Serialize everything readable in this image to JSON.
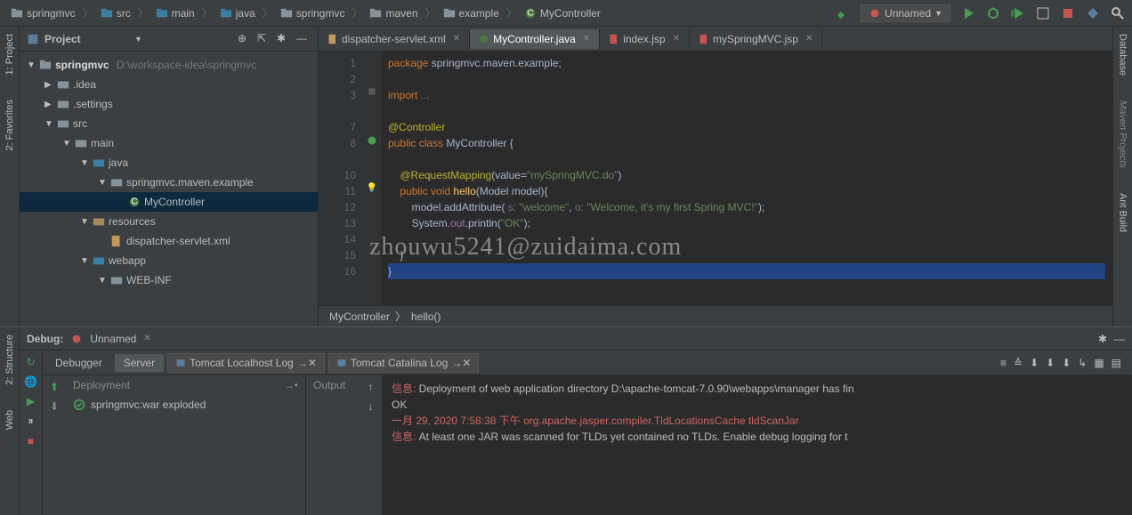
{
  "breadcrumb": [
    "springmvc",
    "src",
    "main",
    "java",
    "springmvc",
    "maven",
    "example",
    "MyController"
  ],
  "runConfig": "Unnamed",
  "projectPanel": {
    "title": "Project"
  },
  "tree": {
    "root": {
      "name": "springmvc",
      "path": "D:\\workspace-idea\\springmvc"
    },
    "idea": ".idea",
    "settings": ".settings",
    "src": "src",
    "main": "main",
    "java": "java",
    "pkg": "springmvc.maven.example",
    "controller": "MyController",
    "resources": "resources",
    "dispatcher": "dispatcher-servlet.xml",
    "webapp": "webapp",
    "webinf": "WEB-INF"
  },
  "tabs": [
    {
      "name": "dispatcher-servlet.xml",
      "active": false
    },
    {
      "name": "MyController.java",
      "active": true
    },
    {
      "name": "index.jsp",
      "active": false
    },
    {
      "name": "mySpringMVC.jsp",
      "active": false
    }
  ],
  "gutterLines": [
    "1",
    "2",
    "3",
    "",
    "7",
    "8",
    "",
    "10",
    "11",
    "12",
    "13",
    "14",
    "15",
    "16"
  ],
  "code": {
    "l1_kw": "package",
    "l1_rest": " springmvc.maven.example;",
    "l3_kw": "import",
    "l3_rest": " ...",
    "l7": "@Controller",
    "l8_pub": "public class ",
    "l8_name": "MyController ",
    "l8_brace": "{",
    "l10_anno": "@RequestMapping",
    "l10_paren": "(value=",
    "l10_str": "\"mySpringMVC.do\"",
    "l10_close": ")",
    "l11_pub": "public void ",
    "l11_method": "hello",
    "l11_param": "(Model model){",
    "l12_a": "        model.addAttribute(",
    "l12_p1": " s: ",
    "l12_s1": "\"welcome\"",
    "l12_c": ", ",
    "l12_p2": "o: ",
    "l12_s2": "\"Welcome, it's my first Spring MVC!\"",
    "l12_end": ");",
    "l13_a": "        System.",
    "l13_out": "out",
    "l13_b": ".println(",
    "l13_s": "\"OK\"",
    "l13_end": ");",
    "l15": "    }",
    "l16": "}"
  },
  "codeBreadcrumb": [
    "MyController",
    "hello()"
  ],
  "rightTabs": [
    "Database",
    "Maven Projects",
    "Ant Build"
  ],
  "leftTabs": [
    "1: Project",
    "2: Favorites",
    "2: Structure",
    "Web"
  ],
  "debug": {
    "title": "Debug:",
    "config": "Unnamed",
    "tabs": {
      "debugger": "Debugger",
      "server": "Server"
    },
    "logs": [
      "Tomcat Localhost Log",
      "Tomcat Catalina Log"
    ],
    "deployHeader": "Deployment",
    "outputHeader": "Output",
    "deployItem": "springmvc:war exploded"
  },
  "console": {
    "l1_label": "信息: ",
    "l1_text": "Deployment of web application directory D:\\apache-tomcat-7.0.90\\webapps\\manager has fin",
    "l2": "OK",
    "l3": "一月 29, 2020 7:58:38 下午 org.apache.jasper.compiler.TldLocationsCache tldScanJar",
    "l4_label": "信息: ",
    "l4_text": "At least one JAR was scanned for TLDs yet contained no TLDs. Enable debug logging for t"
  },
  "watermark": "zhouwu5241@zuidaima.com"
}
